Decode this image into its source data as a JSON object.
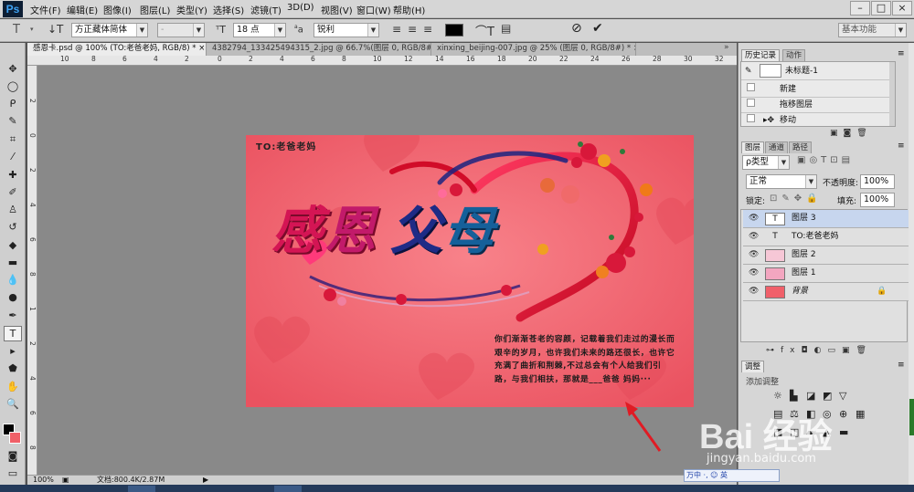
{
  "app": {
    "logo": "Ps"
  },
  "menu": [
    "文件(F)",
    "编辑(E)",
    "图像(I)",
    "图层(L)",
    "类型(Y)",
    "选择(S)",
    "滤镜(T)",
    "3D(D)",
    "视图(V)",
    "窗口(W)",
    "帮助(H)"
  ],
  "window_buttons": [
    "–",
    "□",
    "×"
  ],
  "options": {
    "font_family": "方正藏体简体",
    "font_style": "-",
    "font_size": "18 点",
    "aa_label": "a",
    "aa_mode": "锐利",
    "workspace": "基本功能",
    "text_color": "#000000"
  },
  "doc_tabs": [
    "感恩卡.psd @ 100% (TO:老爸老妈, RGB/8) * ×",
    "4382794_133425494315_2.jpg @ 66.7%(图层 0, RGB/8#) * ×",
    "xinxing_beijing-007.jpg @ 25% (图层 0, RGB/8#) * ×"
  ],
  "ruler_top": [
    "10",
    "8",
    "6",
    "4",
    "2",
    "0",
    "2",
    "4",
    "6",
    "8",
    "10",
    "12",
    "14",
    "16",
    "18",
    "20",
    "22",
    "24",
    "26",
    "28",
    "30",
    "32"
  ],
  "ruler_left": [
    "2",
    "0",
    "2",
    "4",
    "6",
    "8",
    "1",
    "2",
    "4",
    "6",
    "8"
  ],
  "card": {
    "to": "TO:老爸老妈",
    "title_chars": [
      "感",
      "恩",
      "父",
      "母"
    ],
    "message": "你们渐渐苍老的容颜，记载着我们走过的漫长而艰辛的岁月，也许我们未来的路还很长，也许它充满了曲折和荆棘,不过总会有个人给我们引路，与我们相扶，那就是___爸爸 妈妈···"
  },
  "status": {
    "zoom": "100%",
    "doc": "文档:800.4K/2.87M"
  },
  "history_panel": {
    "tabs": [
      "历史记录",
      "动作"
    ],
    "snapshot": "未标题-1",
    "items": [
      "新建",
      "拖移图层",
      "移动"
    ]
  },
  "layers_panel": {
    "tabs": [
      "图层",
      "通道",
      "路径"
    ],
    "kind_label": "ρ类型",
    "blend_mode": "正常",
    "opacity_label": "不透明度:",
    "opacity": "100%",
    "lock_label": "锁定:",
    "fill_label": "填充:",
    "fill": "100%",
    "layers": [
      {
        "name": "图层 3",
        "thumb": "T",
        "selected": true
      },
      {
        "name": "TO:老爸老妈",
        "thumb": "T",
        "selected": false
      },
      {
        "name": "图层 2",
        "thumb": "",
        "selected": false
      },
      {
        "name": "图层 1",
        "thumb": "",
        "selected": false
      },
      {
        "name": "背景",
        "thumb": "",
        "selected": false
      }
    ]
  },
  "adjust_panel": {
    "tabs": [
      "调整"
    ],
    "add_label": "添加调整"
  },
  "watermark": {
    "brand": "Bai 经验",
    "url": "jingyan.baidu.com"
  },
  "ime": {
    "text": "万中 ·, ☺ 英"
  },
  "colors": {
    "bg_card": "#f0606a",
    "title_red": "#d81450",
    "title_blue": "#1e2b86",
    "title_teal": "#1a5a8a",
    "heart_red": "#e01732"
  }
}
